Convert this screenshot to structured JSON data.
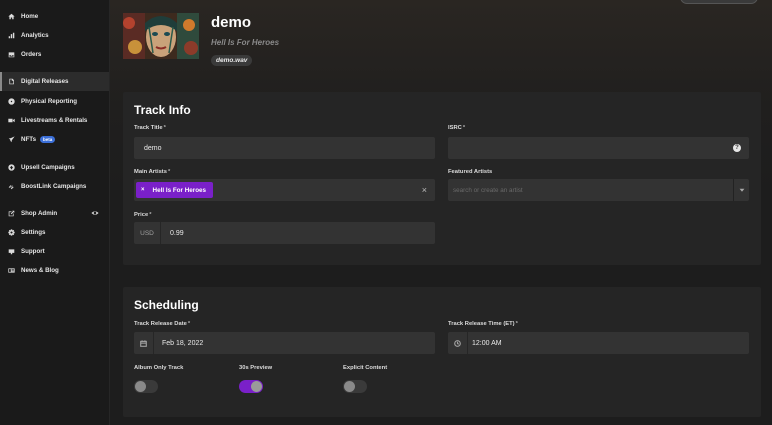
{
  "sidebar": {
    "items": [
      {
        "label": "Home",
        "icon": "home-icon"
      },
      {
        "label": "Analytics",
        "icon": "analytics-icon"
      },
      {
        "label": "Orders",
        "icon": "orders-icon"
      },
      {
        "label": "Digital Releases",
        "icon": "document-icon",
        "active": true
      },
      {
        "label": "Physical Reporting",
        "icon": "disc-icon"
      },
      {
        "label": "Livestreams & Rentals",
        "icon": "video-icon"
      },
      {
        "label": "NFTs",
        "icon": "rocket-icon",
        "badge": "beta"
      },
      {
        "label": "Upsell Campaigns",
        "icon": "upload-icon"
      },
      {
        "label": "BoostLink Campaigns",
        "icon": "link-icon"
      },
      {
        "label": "Shop Admin",
        "icon": "external-link-icon"
      },
      {
        "label": "Settings",
        "icon": "gear-icon"
      },
      {
        "label": "Support",
        "icon": "support-icon"
      },
      {
        "label": "News & Blog",
        "icon": "news-icon"
      }
    ]
  },
  "release": {
    "title": "demo",
    "artist": "Hell Is For Heroes",
    "file": "demo.wav"
  },
  "track_info": {
    "heading": "Track Info",
    "track_title_label": "Track Title",
    "track_title_value": "demo",
    "isrc_label": "ISRC",
    "isrc_value": "",
    "main_artists_label": "Main Artists",
    "main_artist_chip": "Hell Is For Heroes",
    "featured_artists_label": "Featured Artists",
    "featured_artists_placeholder": "search or create an artist",
    "price_label": "Price",
    "currency": "USD",
    "price_value": "0.99"
  },
  "scheduling": {
    "heading": "Scheduling",
    "release_date_label": "Track Release Date",
    "release_date_value": "Feb 18, 2022",
    "release_time_label": "Track Release Time (ET)",
    "release_time_value": "12:00 AM",
    "album_only_label": "Album Only Track",
    "album_only": false,
    "preview_label": "30s Preview",
    "preview": true,
    "explicit_label": "Explicit Content",
    "explicit": false
  },
  "colors": {
    "accent": "#7a20c9",
    "beta_badge": "#3b6fd8"
  }
}
